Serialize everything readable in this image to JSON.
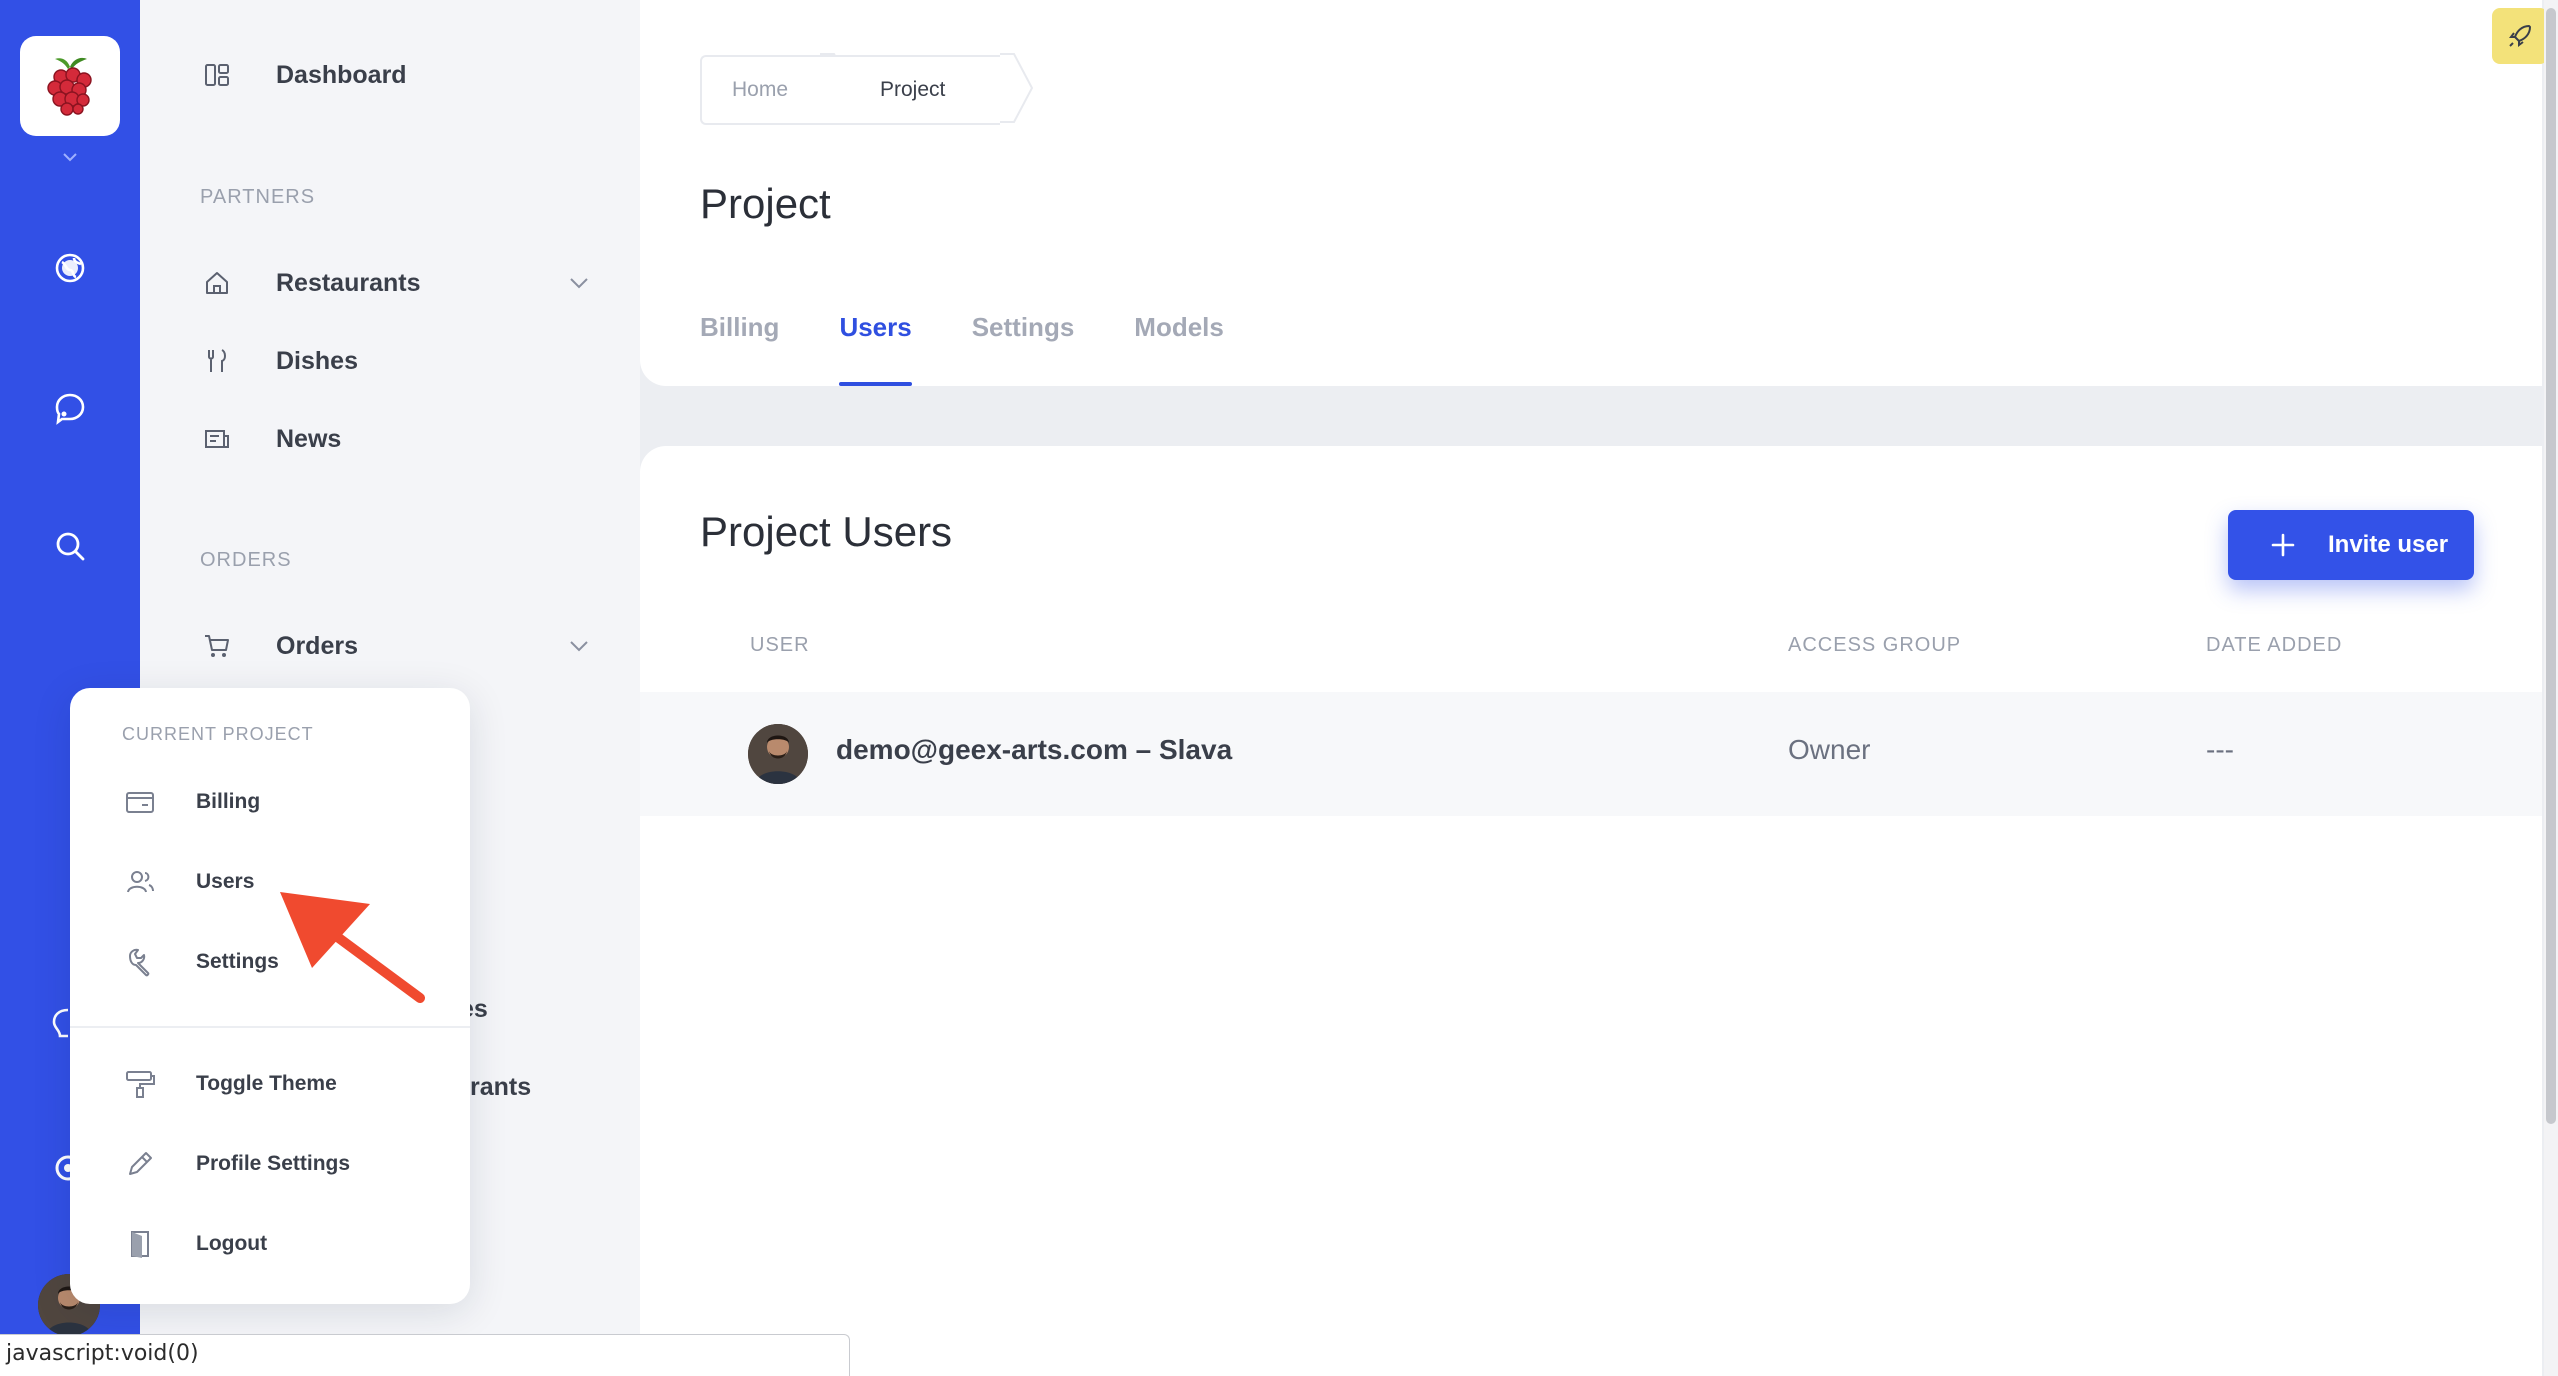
{
  "colors": {
    "accent": "#3250e6",
    "rocket_bg": "#f3e27a",
    "arrow": "#f04a2f"
  },
  "sidebar": {
    "dashboard": "Dashboard",
    "section_partners": "PARTNERS",
    "restaurants": "Restaurants",
    "dishes": "Dishes",
    "news": "News",
    "section_orders": "ORDERS",
    "orders": "Orders",
    "partial_1": "es",
    "partial_2": "rants"
  },
  "breadcrumb": {
    "home": "Home",
    "project": "Project"
  },
  "page": {
    "title": "Project",
    "tabs": [
      {
        "label": "Billing",
        "active": false
      },
      {
        "label": "Users",
        "active": true
      },
      {
        "label": "Settings",
        "active": false
      },
      {
        "label": "Models",
        "active": false
      }
    ]
  },
  "users_card": {
    "title": "Project Users",
    "invite_label": "Invite user",
    "columns": {
      "user": "USER",
      "access": "ACCESS GROUP",
      "date": "DATE ADDED"
    },
    "rows": [
      {
        "user": "demo@geex-arts.com – Slava",
        "access": "Owner",
        "date": "---"
      }
    ]
  },
  "popup": {
    "section": "CURRENT PROJECT",
    "billing": "Billing",
    "users": "Users",
    "settings": "Settings",
    "toggle_theme": "Toggle Theme",
    "profile_settings": "Profile Settings",
    "logout": "Logout"
  },
  "status_bar": "javascript:void(0)"
}
